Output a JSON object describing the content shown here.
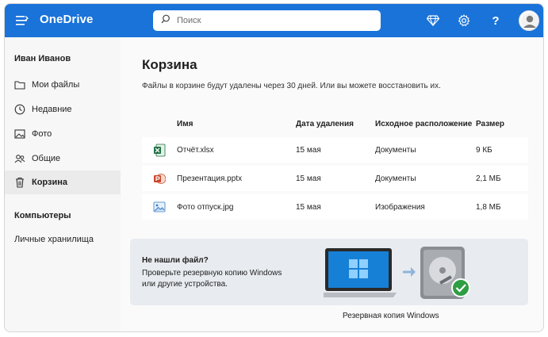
{
  "header": {
    "brand": "OneDrive",
    "search_placeholder": "Поиск",
    "help_label": "?"
  },
  "sidebar": {
    "user_name": "Иван Иванов",
    "items": [
      {
        "label": "Мои файлы",
        "icon": "folder-icon"
      },
      {
        "label": "Недавние",
        "icon": "clock-icon"
      },
      {
        "label": "Фото",
        "icon": "photo-icon"
      },
      {
        "label": "Общие",
        "icon": "people-icon"
      },
      {
        "label": "Корзина",
        "icon": "trash-icon",
        "active": true
      }
    ],
    "section_title": "Компьютеры",
    "vault_label": "Личные хранилища"
  },
  "main": {
    "title": "Корзина",
    "subtitle": "Файлы в корзине будут удалены через 30 дней. Или вы можете восстановить их.",
    "columns": {
      "name": "Имя",
      "deleted": "Дата удаления",
      "location": "Исходное расположение",
      "size": "Размер"
    },
    "rows": [
      {
        "name": "Отчёт.xlsx",
        "deleted": "15 мая",
        "location": "Документы",
        "size": "9 КБ",
        "icon": "excel-icon"
      },
      {
        "name": "Презентация.pptx",
        "deleted": "15 мая",
        "location": "Документы",
        "size": "2,1 МБ",
        "icon": "powerpoint-icon"
      },
      {
        "name": "Фото отпуск.jpg",
        "deleted": "15 мая",
        "location": "Изображения",
        "size": "1,8 МБ",
        "icon": "image-icon"
      }
    ],
    "promo": {
      "title": "Не нашли файл?",
      "line1": "Проверьте резервную копию Windows",
      "line2": "или другие устройства.",
      "caption": "Резервная копия Windows"
    }
  },
  "colors": {
    "brand_blue": "#1a73d9",
    "excel_green": "#1d7044",
    "powerpoint_orange": "#c9472a",
    "check_green": "#2e9e44"
  }
}
